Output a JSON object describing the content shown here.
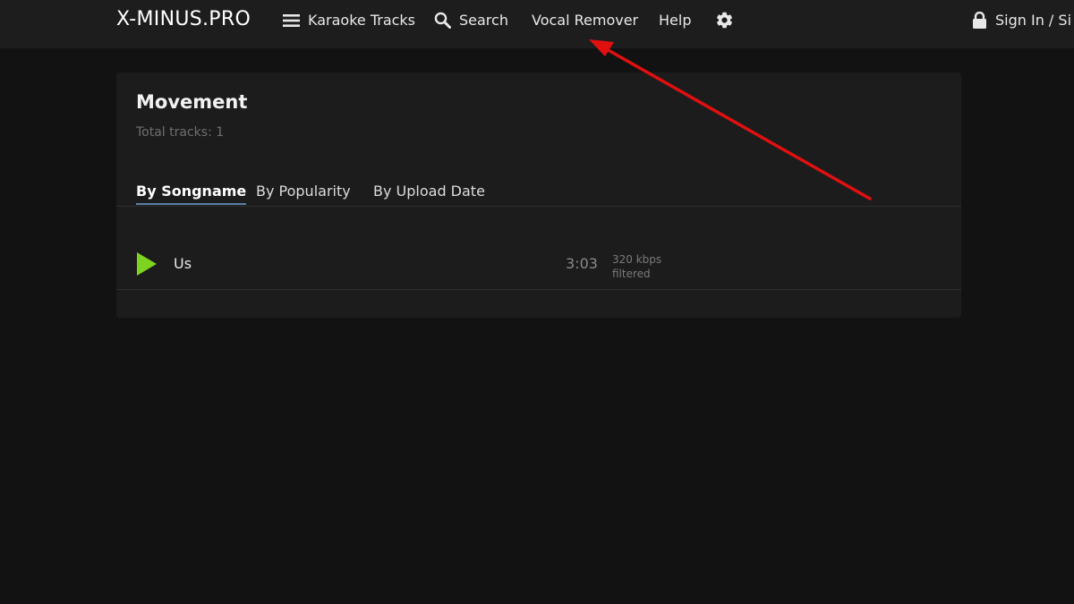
{
  "header": {
    "logo": "X-MINUS.PRO",
    "nav": {
      "karaoke_tracks": "Karaoke Tracks",
      "search": "Search",
      "vocal_remover": "Vocal Remover",
      "help": "Help",
      "sign_in": "Sign In / Si"
    },
    "icons": {
      "menu": "menu-icon",
      "search": "search-icon",
      "settings": "gear-icon",
      "lock": "lock-icon"
    }
  },
  "artist": {
    "title": "Movement",
    "total_tracks": "Total tracks: 1"
  },
  "sort_tabs": [
    {
      "label": "By Songname",
      "active": true
    },
    {
      "label": "By Popularity",
      "active": false
    },
    {
      "label": "By Upload Date",
      "active": false
    }
  ],
  "tracks": [
    {
      "name": "Us",
      "duration": "3:03",
      "bitrate": "320 kbps",
      "note": "filtered"
    }
  ],
  "colors": {
    "accent_play": "#7ed321",
    "annotation_arrow": "#e01010",
    "tab_underline": "#5a7fa8"
  }
}
